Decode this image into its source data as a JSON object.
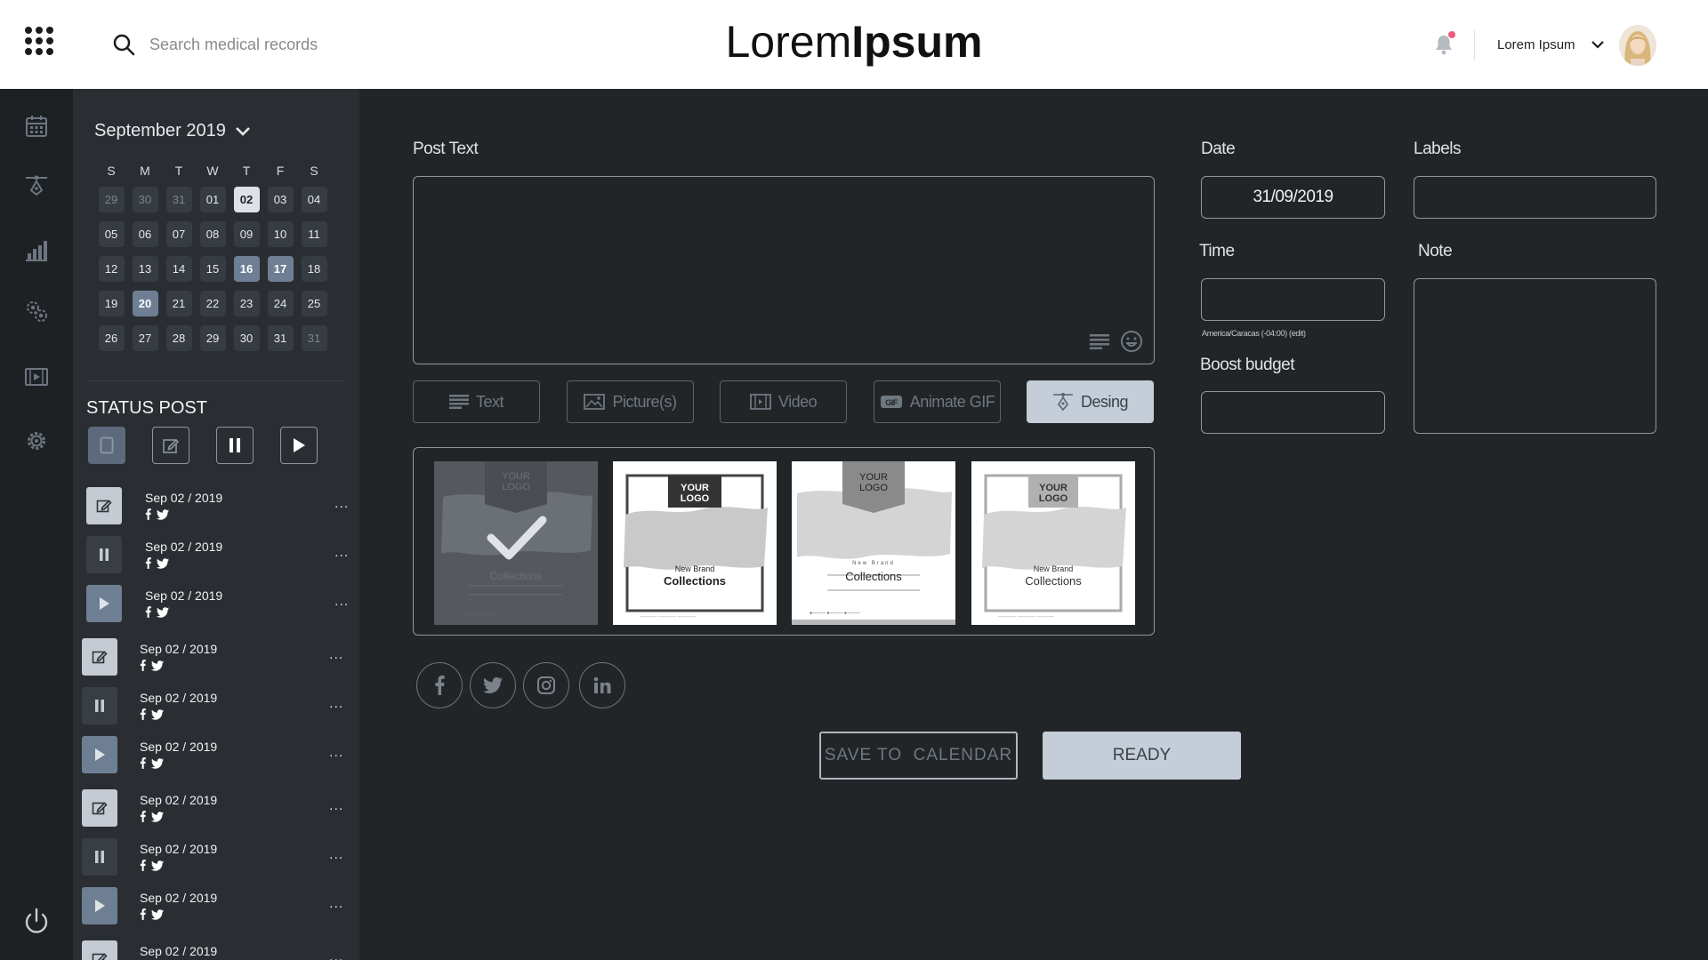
{
  "header": {
    "search_placeholder": "Search medical records",
    "logo_light": "Lorem",
    "logo_bold": "Ipsum",
    "user_name": "Lorem Ipsum",
    "notification_color": "#f05c7e"
  },
  "rail": {
    "icons": [
      "calendar-icon",
      "design-tool-icon",
      "bar-chart-icon",
      "settings-cluster-icon",
      "video-icon",
      "gear-icon"
    ],
    "footer_icon": "power-icon"
  },
  "calendar": {
    "month_label": "September 2019",
    "weekdays": [
      "S",
      "M",
      "T",
      "W",
      "T",
      "F",
      "S"
    ],
    "weeks": [
      [
        {
          "d": "29",
          "s": "muted"
        },
        {
          "d": "30",
          "s": "muted"
        },
        {
          "d": "31",
          "s": "muted"
        },
        {
          "d": "01",
          "s": ""
        },
        {
          "d": "02",
          "s": "today"
        },
        {
          "d": "03",
          "s": ""
        },
        {
          "d": "04",
          "s": ""
        }
      ],
      [
        {
          "d": "05",
          "s": ""
        },
        {
          "d": "06",
          "s": ""
        },
        {
          "d": "07",
          "s": ""
        },
        {
          "d": "08",
          "s": ""
        },
        {
          "d": "09",
          "s": ""
        },
        {
          "d": "10",
          "s": ""
        },
        {
          "d": "11",
          "s": ""
        }
      ],
      [
        {
          "d": "12",
          "s": ""
        },
        {
          "d": "13",
          "s": ""
        },
        {
          "d": "14",
          "s": ""
        },
        {
          "d": "15",
          "s": ""
        },
        {
          "d": "16",
          "s": "hl"
        },
        {
          "d": "17",
          "s": "hl"
        },
        {
          "d": "18",
          "s": ""
        }
      ],
      [
        {
          "d": "19",
          "s": ""
        },
        {
          "d": "20",
          "s": "hl"
        },
        {
          "d": "21",
          "s": ""
        },
        {
          "d": "22",
          "s": ""
        },
        {
          "d": "23",
          "s": ""
        },
        {
          "d": "24",
          "s": ""
        },
        {
          "d": "25",
          "s": ""
        }
      ],
      [
        {
          "d": "26",
          "s": ""
        },
        {
          "d": "27",
          "s": ""
        },
        {
          "d": "28",
          "s": ""
        },
        {
          "d": "29",
          "s": ""
        },
        {
          "d": "30",
          "s": ""
        },
        {
          "d": "31",
          "s": ""
        },
        {
          "d": "31",
          "s": "muted"
        }
      ]
    ]
  },
  "status": {
    "title": "STATUS POST",
    "filters": [
      "all",
      "edit",
      "pause",
      "play"
    ],
    "posts": [
      {
        "type": "edit",
        "date": "Sep 02 / 2019"
      },
      {
        "type": "pause",
        "date": "Sep 02 / 2019"
      },
      {
        "type": "play",
        "date": "Sep 02 / 2019"
      },
      {
        "type": "edit",
        "date": "Sep 02 / 2019"
      },
      {
        "type": "pause",
        "date": "Sep 02 / 2019"
      },
      {
        "type": "play",
        "date": "Sep 02 / 2019"
      },
      {
        "type": "edit",
        "date": "Sep 02 / 2019"
      },
      {
        "type": "pause",
        "date": "Sep 02 / 2019"
      },
      {
        "type": "play",
        "date": "Sep 02 / 2019"
      },
      {
        "type": "edit",
        "date": "Sep 02 / 2019"
      }
    ],
    "more": "..."
  },
  "form": {
    "post_text_label": "Post Text",
    "post_text_value": "",
    "date_label": "Date",
    "date_value": "31/09/2019",
    "labels_label": "Labels",
    "time_label": "Time",
    "timezone": "America/Caracas (-04:00) (edit)",
    "note_label": "Note",
    "boost_label": "Boost budget"
  },
  "tools": [
    {
      "label": "Text",
      "icon": "text-lines-icon",
      "active": false
    },
    {
      "label": "Picture(s)",
      "icon": "picture-icon",
      "active": false
    },
    {
      "label": "Video",
      "icon": "film-icon",
      "active": false
    },
    {
      "label": "Animate GIF",
      "icon": "gif-icon",
      "active": false
    },
    {
      "label": "Desing",
      "icon": "pen-tool-icon",
      "active": true
    }
  ],
  "templates": [
    {
      "variant": "banner",
      "selected": true,
      "logo1": "YOUR",
      "logo2": "LOGO",
      "brand": "",
      "title": "Collections"
    },
    {
      "variant": "frame",
      "selected": false,
      "logo1": "YOUR",
      "logo2": "LOGO",
      "brand": "New Brand",
      "title": "Collections"
    },
    {
      "variant": "banner",
      "selected": false,
      "logo1": "YOUR",
      "logo2": "LOGO",
      "brand": "New Brand",
      "title": "Collections"
    },
    {
      "variant": "frame-light",
      "selected": false,
      "logo1": "YOUR",
      "logo2": "LOGO",
      "brand": "New Brand",
      "title": "Collections"
    }
  ],
  "socials": [
    "facebook-icon",
    "twitter-icon",
    "instagram-icon",
    "linkedin-icon"
  ],
  "actions": {
    "save": "SAVE TO  CALENDAR",
    "ready": "READY"
  }
}
